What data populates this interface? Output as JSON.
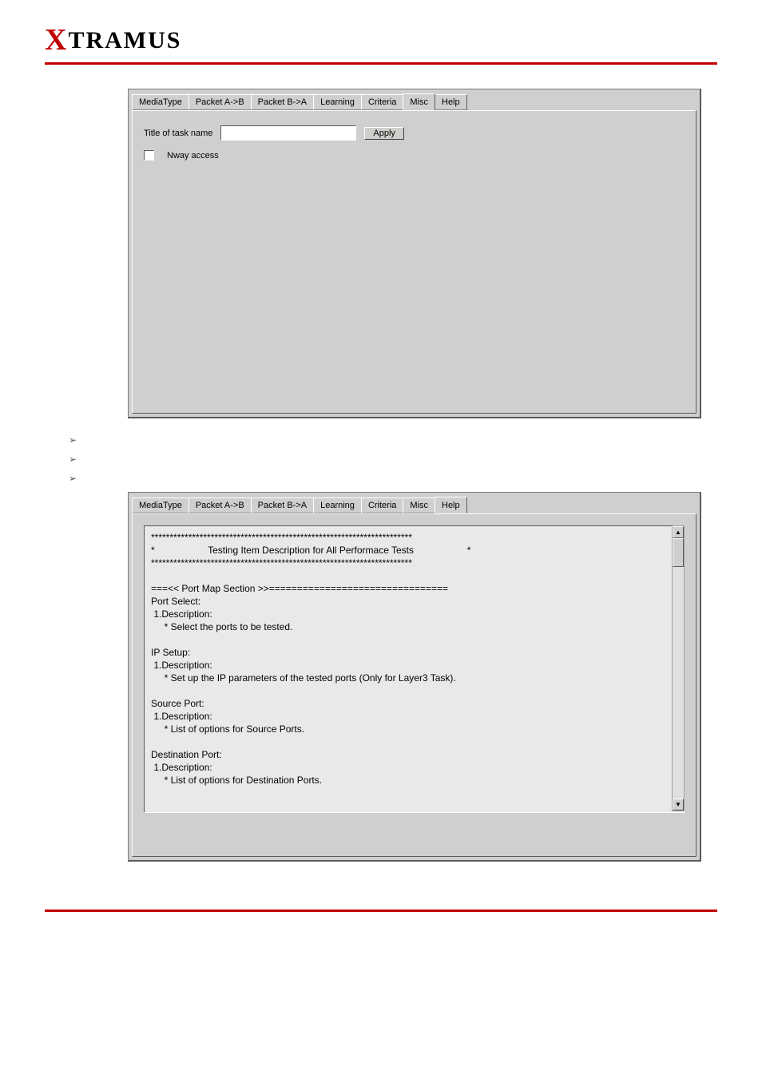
{
  "logo": {
    "x": "X",
    "rest": "TRAMUS"
  },
  "panel1": {
    "tabs": [
      "MediaType",
      "Packet A->B",
      "Packet B->A",
      "Learning",
      "Criteria",
      "Misc",
      "Help"
    ],
    "activeTab": "Misc",
    "titleLabel": "Title of task name",
    "applyBtn": "Apply",
    "nwayLabel": "Nway access"
  },
  "bulletLines": [
    "",
    "",
    ""
  ],
  "panel2": {
    "tabs": [
      "MediaType",
      "Packet A->B",
      "Packet B->A",
      "Learning",
      "Criteria",
      "Misc",
      "Help"
    ],
    "activeTab": "Help",
    "content": "**********************************************************************\n*                    Testing Item Description for All Performace Tests                    *\n**********************************************************************\n\n===<< Port Map Section >>================================\nPort Select:\n 1.Description:\n     * Select the ports to be tested.\n\nIP Setup:\n 1.Description:\n     * Set up the IP parameters of the tested ports (Only for Layer3 Task).\n\nSource Port:\n 1.Description:\n     * List of options for Source Ports.\n\nDestination Port:\n 1.Description:\n     * List of options for Destination Ports."
  }
}
